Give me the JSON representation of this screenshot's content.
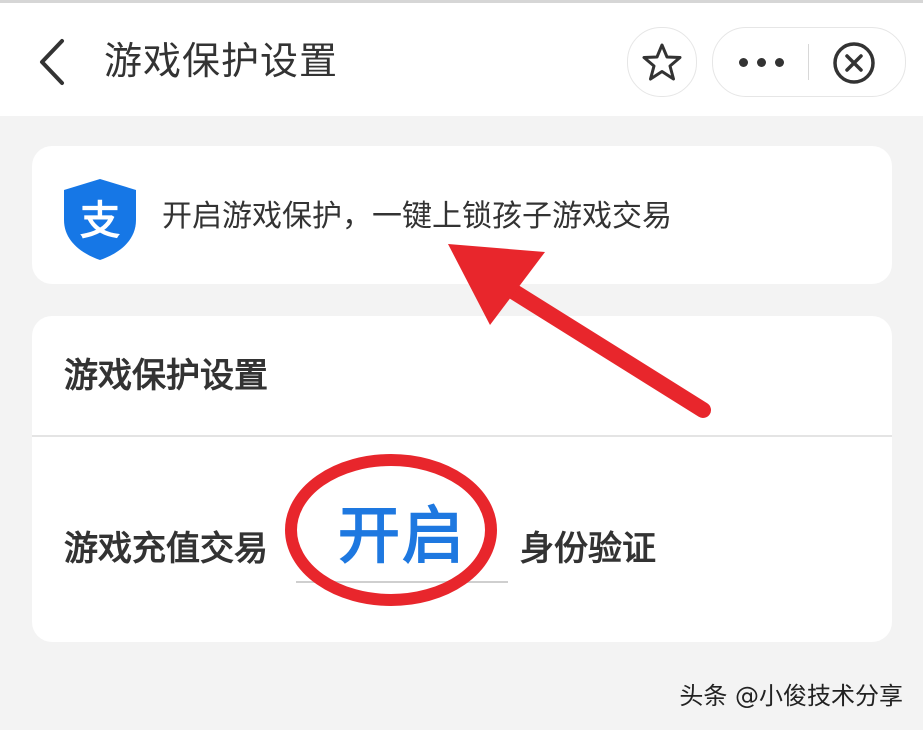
{
  "header": {
    "title": "游戏保护设置",
    "back_icon": "chevron-left-icon",
    "favorite_icon": "star-icon",
    "more_icon": "more-dots-icon",
    "close_icon": "close-circle-icon"
  },
  "banner": {
    "logo": "alipay-shield-logo",
    "logo_text": "支",
    "text": "开启游戏保护，一键上锁孩子游戏交易"
  },
  "settings": {
    "section_title": "游戏保护设置",
    "row": {
      "label": "游戏充值交易",
      "action": "开启",
      "suffix": "身份验证"
    }
  },
  "colors": {
    "accent_blue": "#1e78e0",
    "annotation_red": "#e8262c",
    "background": "#f3f3f3",
    "card": "#ffffff"
  },
  "watermark": "头条 @小俊技术分享"
}
